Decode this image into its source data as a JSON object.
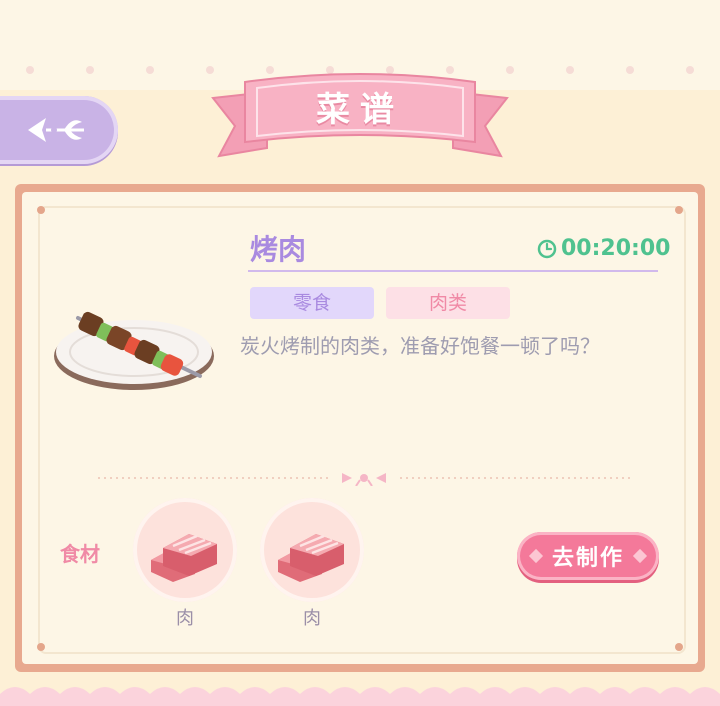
{
  "header": {
    "title": "菜谱"
  },
  "back_button": {
    "icon": "ornate-back-arrow-icon"
  },
  "recipe": {
    "name": "烤肉",
    "cook_time": "00:20:00",
    "tags": [
      "零食",
      "肉类"
    ],
    "description": "炭火烤制的肉类，准备好饱餐一顿了吗？",
    "image": "kebab-skewer-on-plate"
  },
  "ingredients": {
    "label": "食材",
    "items": [
      {
        "name": "肉",
        "icon": "meat-slab-icon"
      },
      {
        "name": "肉",
        "icon": "meat-slab-icon"
      }
    ]
  },
  "actions": {
    "make_label": "去制作"
  },
  "colors": {
    "background": "#fdf0d6",
    "accent_purple": "#a98ae0",
    "accent_pink": "#f4799a",
    "timer_green": "#4fc28f",
    "frame_border": "#e8a98f"
  }
}
